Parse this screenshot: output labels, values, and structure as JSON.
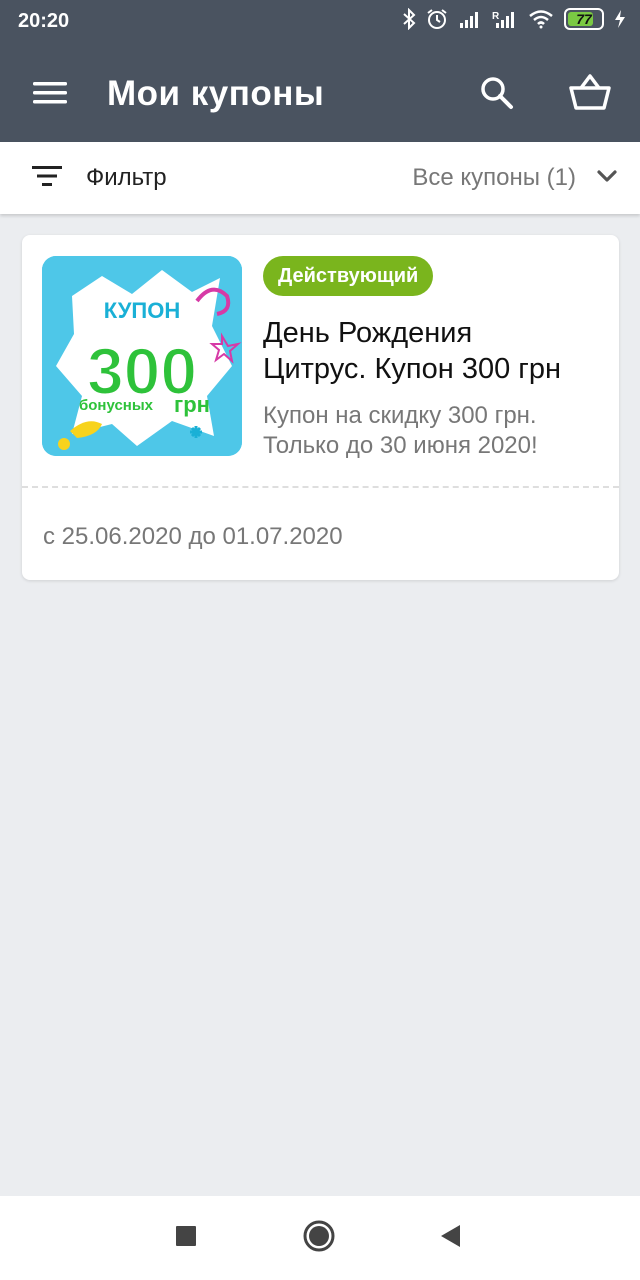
{
  "status_bar": {
    "time": "20:20",
    "battery_level": "77",
    "icons": [
      "bluetooth-icon",
      "alarm-icon",
      "signal-icon",
      "signal-roaming-icon",
      "wifi-icon",
      "battery-icon",
      "charging-icon"
    ]
  },
  "app_bar": {
    "title": "Мои купоны",
    "background": "#4a5360",
    "icons": [
      "menu-icon",
      "search-icon",
      "basket-icon"
    ]
  },
  "filter_bar": {
    "filter_label": "Фильтр",
    "dropdown_selected": "Все купоны (1)"
  },
  "coupons": [
    {
      "status": "Действующий",
      "status_color": "#7ab51d",
      "title_line1": "День Рождения",
      "title_line2": "Цитрус. Купон 300 грн",
      "description": "Купон на скидку 300 грн. Только до 30 июня 2020!",
      "dates": "с 25.06.2020 до 01.07.2020",
      "image": {
        "top_text": "КУПОН",
        "amount": "300",
        "bottom_left": "бонусных",
        "bottom_right": "грн"
      }
    }
  ],
  "nav_bar": {
    "icons": [
      "recents-square-icon",
      "home-circle-icon",
      "back-triangle-icon"
    ]
  }
}
